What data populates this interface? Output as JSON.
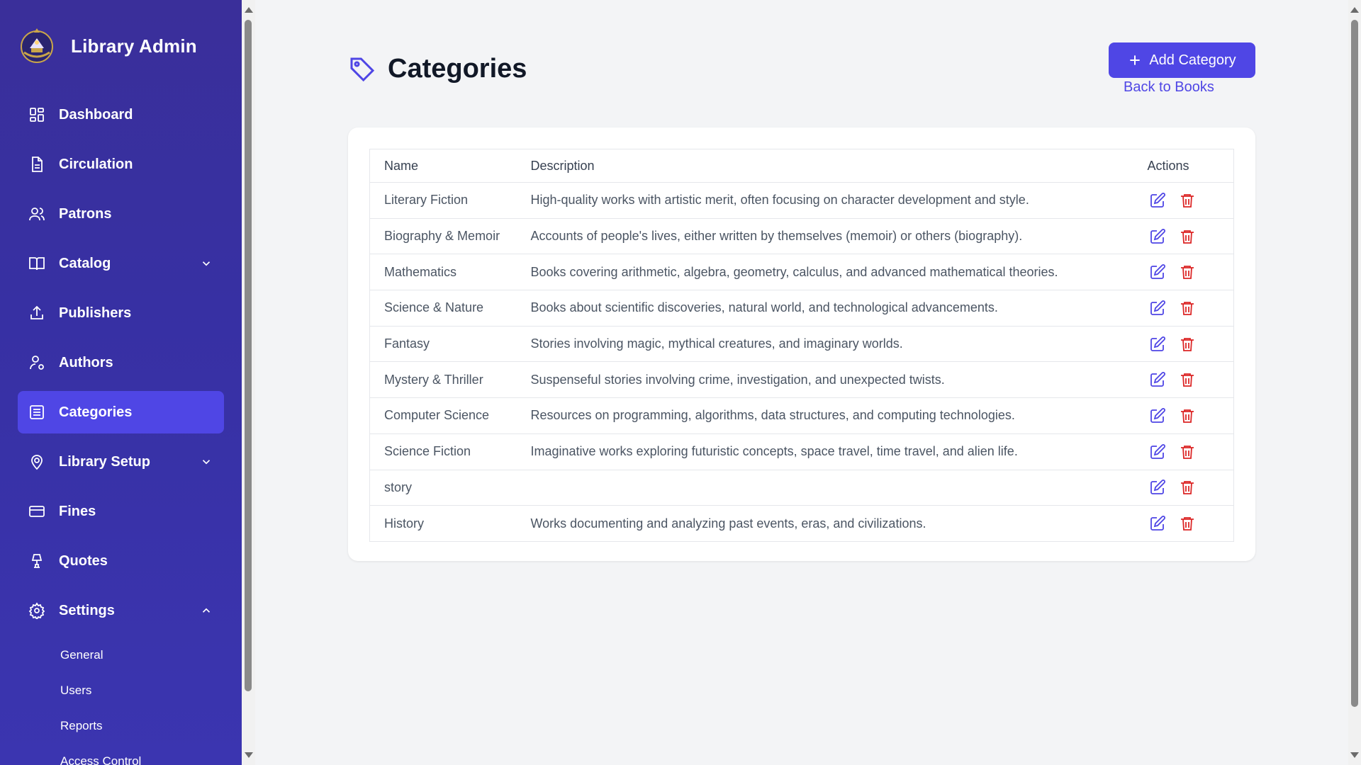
{
  "app": {
    "title": "Library Admin"
  },
  "colors": {
    "sidebar": "#3730a3",
    "accent": "#4f46e5",
    "danger": "#dc2626"
  },
  "sidebar": {
    "items": [
      {
        "label": "Dashboard",
        "icon": "dashboard-icon"
      },
      {
        "label": "Circulation",
        "icon": "document-icon"
      },
      {
        "label": "Patrons",
        "icon": "users-icon"
      },
      {
        "label": "Catalog",
        "icon": "book-open-icon",
        "expandable": true
      },
      {
        "label": "Publishers",
        "icon": "upload-icon"
      },
      {
        "label": "Authors",
        "icon": "user-cog-icon"
      },
      {
        "label": "Categories",
        "icon": "list-icon",
        "active": true
      },
      {
        "label": "Library Setup",
        "icon": "map-pin-icon",
        "expandable": true
      },
      {
        "label": "Fines",
        "icon": "credit-card-icon"
      },
      {
        "label": "Quotes",
        "icon": "lamp-icon"
      },
      {
        "label": "Settings",
        "icon": "gear-icon",
        "expanded": true
      }
    ],
    "settings_sub": [
      "General",
      "Users",
      "Reports",
      "Access Control"
    ]
  },
  "header": {
    "title": "Categories",
    "add_label": "Add Category",
    "back_label": "Back to Books"
  },
  "table": {
    "columns": [
      "Name",
      "Description",
      "Actions"
    ],
    "rows": [
      {
        "name": "Literary Fiction",
        "description": "High-quality works with artistic merit, often focusing on character development and style."
      },
      {
        "name": "Biography & Memoir",
        "description": "Accounts of people's lives, either written by themselves (memoir) or others (biography)."
      },
      {
        "name": "Mathematics",
        "description": "Books covering arithmetic, algebra, geometry, calculus, and advanced mathematical theories."
      },
      {
        "name": "Science & Nature",
        "description": "Books about scientific discoveries, natural world, and technological advancements."
      },
      {
        "name": "Fantasy",
        "description": "Stories involving magic, mythical creatures, and imaginary worlds."
      },
      {
        "name": "Mystery & Thriller",
        "description": "Suspenseful stories involving crime, investigation, and unexpected twists."
      },
      {
        "name": "Computer Science",
        "description": "Resources on programming, algorithms, data structures, and computing technologies."
      },
      {
        "name": "Science Fiction",
        "description": "Imaginative works exploring futuristic concepts, space travel, time travel, and alien life."
      },
      {
        "name": "story",
        "description": ""
      },
      {
        "name": "History",
        "description": "Works documenting and analyzing past events, eras, and civilizations."
      }
    ]
  }
}
